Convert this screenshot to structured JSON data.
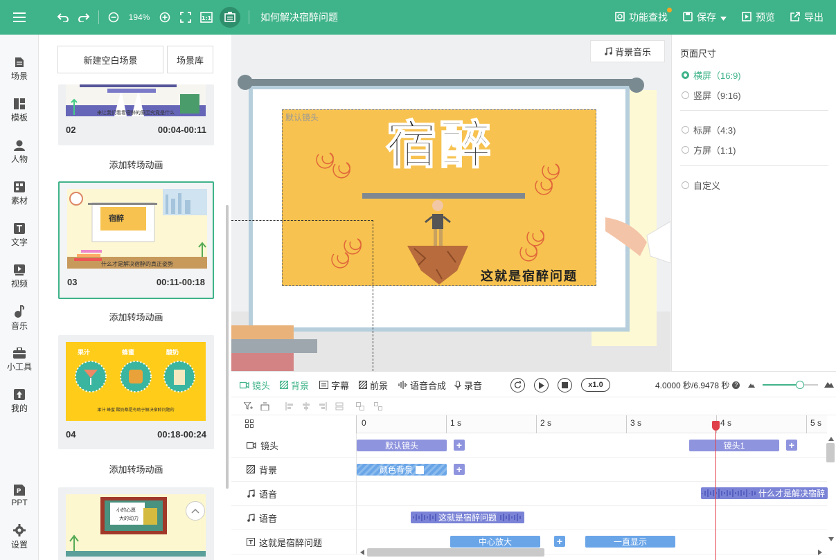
{
  "topbar": {
    "zoom": "194%",
    "title": "如何解决宿醉问题",
    "feature_search": "功能查找",
    "save": "保存",
    "preview": "预览",
    "export": "导出",
    "accent": "#3fb389"
  },
  "nav": [
    {
      "label": "场景",
      "icon": "scene-icon"
    },
    {
      "label": "模板",
      "icon": "template-icon"
    },
    {
      "label": "人物",
      "icon": "person-icon"
    },
    {
      "label": "素材",
      "icon": "material-icon"
    },
    {
      "label": "文字",
      "icon": "text-icon"
    },
    {
      "label": "视频",
      "icon": "video-icon"
    },
    {
      "label": "音乐",
      "icon": "music-icon"
    },
    {
      "label": "小工具",
      "icon": "toolbox-icon"
    },
    {
      "label": "我的",
      "icon": "upload-icon"
    },
    {
      "label": "PPT",
      "icon": "ppt-icon"
    },
    {
      "label": "设置",
      "icon": "gear-icon"
    }
  ],
  "scenes": {
    "new_blank": "新建空白场景",
    "library": "场景库",
    "add_transition": "添加转场动画",
    "items": [
      {
        "num": "02",
        "time": "00:04-00:11",
        "thumb_text": "来让我们看看宿醉的原因究竟是什么"
      },
      {
        "num": "03",
        "time": "00:11-00:18",
        "thumb_title": "宿醉",
        "thumb_text": "什么才是解决宿醉的真正姿势"
      },
      {
        "num": "04",
        "time": "00:18-00:24",
        "labels": [
          "果汁",
          "蜂蜜",
          "酸奶"
        ],
        "thumb_text": "果汁 蜂蜜 酸奶都是有助于解决宿醉问题的"
      }
    ],
    "card5_text": [
      "小的心愿",
      "大的动力"
    ]
  },
  "canvas": {
    "bgm": "背景音乐",
    "lens_label": "默认镜头",
    "title_big": "宿醉",
    "subtitle": "这就是宿醉问题",
    "board_bg": "#f7c24f"
  },
  "props": {
    "title": "页面尺寸",
    "options": [
      {
        "label": "横屏（16:9)",
        "checked": true
      },
      {
        "label": "竖屏（9:16)",
        "checked": false
      },
      {
        "label": "标屏（4:3)",
        "checked": false
      },
      {
        "label": "方屏（1:1)",
        "checked": false
      },
      {
        "label": "自定义",
        "checked": false
      }
    ]
  },
  "timeline": {
    "tabs": [
      "镜头",
      "背景",
      "字幕",
      "前景",
      "语音合成",
      "录音"
    ],
    "speed": "x1.0",
    "time": "4.0000 秒/6.9478 秒",
    "ticks": [
      "0",
      "1 s",
      "2 s",
      "3 s",
      "4 s",
      "5 s"
    ],
    "tracks": [
      {
        "label": "镜头",
        "icon": "camera-icon"
      },
      {
        "label": "背景",
        "icon": "hatch-icon"
      },
      {
        "label": "语音",
        "icon": "music-note-icon"
      },
      {
        "label": "语音",
        "icon": "music-note-icon"
      },
      {
        "label": "这就是宿醉问题",
        "icon": "text-box-icon"
      }
    ],
    "clips": {
      "lens_default": "默认镜头",
      "lens_1": "镜头1",
      "bg_color": "颜色背景",
      "voice1": "什么才是解决宿醉",
      "voice2": "这就是宿醉问题",
      "text_enter": "中心放大",
      "text_stay": "一直显示"
    },
    "progress": 0.576
  }
}
